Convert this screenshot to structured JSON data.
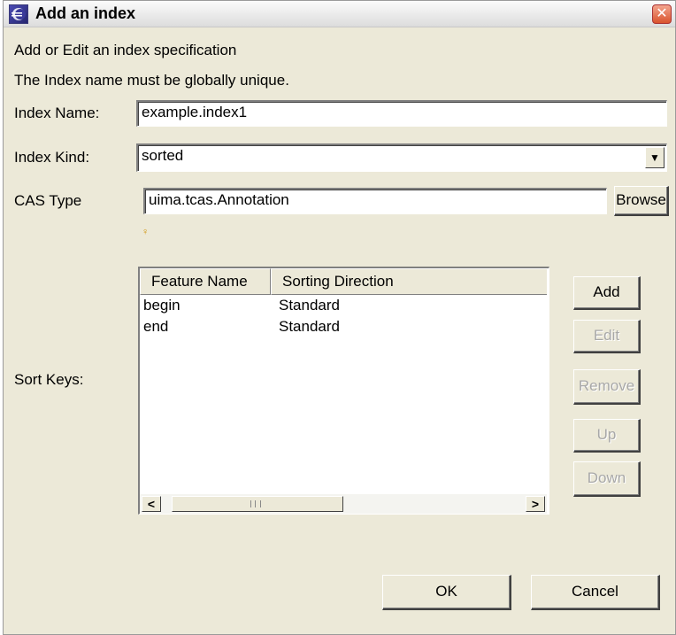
{
  "window": {
    "title": "Add an index"
  },
  "description": {
    "line1": "Add or Edit an index specification",
    "line2": "The Index name must be globally unique."
  },
  "form": {
    "index_name_label": "Index Name:",
    "index_name_value": "example.index1",
    "index_kind_label": "Index Kind:",
    "index_kind_value": "sorted",
    "cas_type_label": "CAS Type",
    "cas_type_value": "uima.tcas.Annotation",
    "browse_label": "Browse",
    "sort_keys_label": "Sort Keys:"
  },
  "sort_table": {
    "columns": [
      "Feature Name",
      "Sorting Direction"
    ],
    "rows": [
      {
        "feature": "begin",
        "direction": "Standard"
      },
      {
        "feature": "end",
        "direction": "Standard"
      }
    ]
  },
  "side_buttons": {
    "add": "Add",
    "edit": "Edit",
    "remove": "Remove",
    "up": "Up",
    "down": "Down"
  },
  "footer": {
    "ok": "OK",
    "cancel": "Cancel"
  },
  "icons": {
    "app": "eclipse-icon",
    "close": "close-icon",
    "combo": "chevron-down-icon",
    "scroll_left": "arrow-left-icon",
    "scroll_right": "arrow-right-icon",
    "content_assist": "lightbulb-icon"
  }
}
